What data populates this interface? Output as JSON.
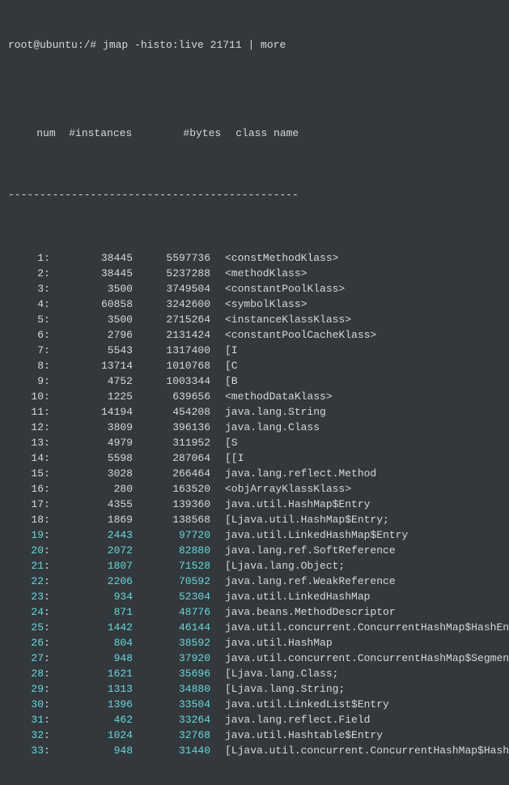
{
  "command": "root@ubuntu:/# jmap -histo:live 21711 | more",
  "headers": {
    "num": "num",
    "instances": "#instances",
    "bytes": "#bytes",
    "class_name": "class name"
  },
  "dashes": "----------------------------------------------",
  "rows": [
    {
      "num": "1",
      "instances": "38445",
      "bytes": "5597736",
      "class": "<constMethodKlass>",
      "hi": false
    },
    {
      "num": "2",
      "instances": "38445",
      "bytes": "5237288",
      "class": "<methodKlass>",
      "hi": false
    },
    {
      "num": "3",
      "instances": "3500",
      "bytes": "3749504",
      "class": "<constantPoolKlass>",
      "hi": false
    },
    {
      "num": "4",
      "instances": "60858",
      "bytes": "3242600",
      "class": "<symbolKlass>",
      "hi": false
    },
    {
      "num": "5",
      "instances": "3500",
      "bytes": "2715264",
      "class": "<instanceKlassKlass>",
      "hi": false
    },
    {
      "num": "6",
      "instances": "2796",
      "bytes": "2131424",
      "class": "<constantPoolCacheKlass>",
      "hi": false
    },
    {
      "num": "7",
      "instances": "5543",
      "bytes": "1317400",
      "class": "[I",
      "hi": false
    },
    {
      "num": "8",
      "instances": "13714",
      "bytes": "1010768",
      "class": "[C",
      "hi": false
    },
    {
      "num": "9",
      "instances": "4752",
      "bytes": "1003344",
      "class": "[B",
      "hi": false
    },
    {
      "num": "10",
      "instances": "1225",
      "bytes": "639656",
      "class": "<methodDataKlass>",
      "hi": false
    },
    {
      "num": "11",
      "instances": "14194",
      "bytes": "454208",
      "class": "java.lang.String",
      "hi": false
    },
    {
      "num": "12",
      "instances": "3809",
      "bytes": "396136",
      "class": "java.lang.Class",
      "hi": false
    },
    {
      "num": "13",
      "instances": "4979",
      "bytes": "311952",
      "class": "[S",
      "hi": false
    },
    {
      "num": "14",
      "instances": "5598",
      "bytes": "287064",
      "class": "[[I",
      "hi": false
    },
    {
      "num": "15",
      "instances": "3028",
      "bytes": "266464",
      "class": "java.lang.reflect.Method",
      "hi": false
    },
    {
      "num": "16",
      "instances": "280",
      "bytes": "163520",
      "class": "<objArrayKlassKlass>",
      "hi": false
    },
    {
      "num": "17",
      "instances": "4355",
      "bytes": "139360",
      "class": "java.util.HashMap$Entry",
      "hi": false
    },
    {
      "num": "18",
      "instances": "1869",
      "bytes": "138568",
      "class": "[Ljava.util.HashMap$Entry;",
      "hi": false
    },
    {
      "num": "19",
      "instances": "2443",
      "bytes": "97720",
      "class": "java.util.LinkedHashMap$Entry",
      "hi": true
    },
    {
      "num": "20",
      "instances": "2072",
      "bytes": "82880",
      "class": "java.lang.ref.SoftReference",
      "hi": true
    },
    {
      "num": "21",
      "instances": "1807",
      "bytes": "71528",
      "class": "[Ljava.lang.Object;",
      "hi": true
    },
    {
      "num": "22",
      "instances": "2206",
      "bytes": "70592",
      "class": "java.lang.ref.WeakReference",
      "hi": true
    },
    {
      "num": "23",
      "instances": "934",
      "bytes": "52304",
      "class": "java.util.LinkedHashMap",
      "hi": true
    },
    {
      "num": "24",
      "instances": "871",
      "bytes": "48776",
      "class": "java.beans.MethodDescriptor",
      "hi": true
    },
    {
      "num": "25",
      "instances": "1442",
      "bytes": "46144",
      "class": "java.util.concurrent.ConcurrentHashMap$HashEntry",
      "hi": true
    },
    {
      "num": "26",
      "instances": "804",
      "bytes": "38592",
      "class": "java.util.HashMap",
      "hi": true
    },
    {
      "num": "27",
      "instances": "948",
      "bytes": "37920",
      "class": "java.util.concurrent.ConcurrentHashMap$Segment",
      "hi": true
    },
    {
      "num": "28",
      "instances": "1621",
      "bytes": "35696",
      "class": "[Ljava.lang.Class;",
      "hi": true
    },
    {
      "num": "29",
      "instances": "1313",
      "bytes": "34880",
      "class": "[Ljava.lang.String;",
      "hi": true
    },
    {
      "num": "30",
      "instances": "1396",
      "bytes": "33504",
      "class": "java.util.LinkedList$Entry",
      "hi": true
    },
    {
      "num": "31",
      "instances": "462",
      "bytes": "33264",
      "class": "java.lang.reflect.Field",
      "hi": true
    },
    {
      "num": "32",
      "instances": "1024",
      "bytes": "32768",
      "class": "java.util.Hashtable$Entry",
      "hi": true
    },
    {
      "num": "33",
      "instances": "948",
      "bytes": "31440",
      "class": "[Ljava.util.concurrent.ConcurrentHashMap$HashEntry;",
      "hi": true
    }
  ]
}
